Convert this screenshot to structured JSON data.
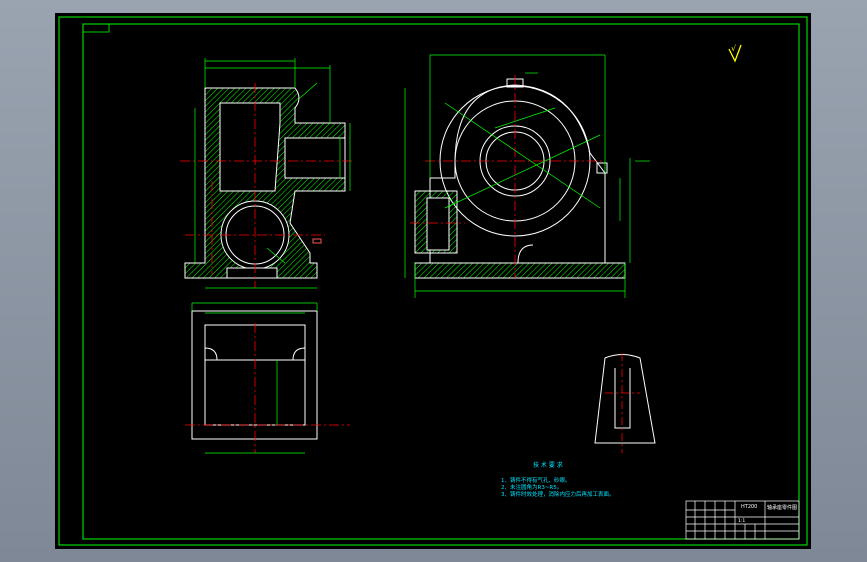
{
  "drawing": {
    "tech_req_title": "技 术 要 求",
    "tech_req_items": [
      "1、铸件不得有气孔、砂眼。",
      "2、未注圆角为R3~R5。",
      "3、铸件时效处理，消除内应力后再加工表面。"
    ],
    "title_block": {
      "part_code": "HT200",
      "part_name": "轴承座零件图",
      "school": "",
      "scale_label": "1:1"
    },
    "roughness_symbol": "√"
  },
  "colors": {
    "background": "#000000",
    "outline": "#ffffff",
    "frame": "#00ff00",
    "dimension": "#00ff00",
    "centerline": "#ff0000",
    "hatch": "#00ff00",
    "text_note": "#00e5ff",
    "symbol": "#ffff00"
  }
}
